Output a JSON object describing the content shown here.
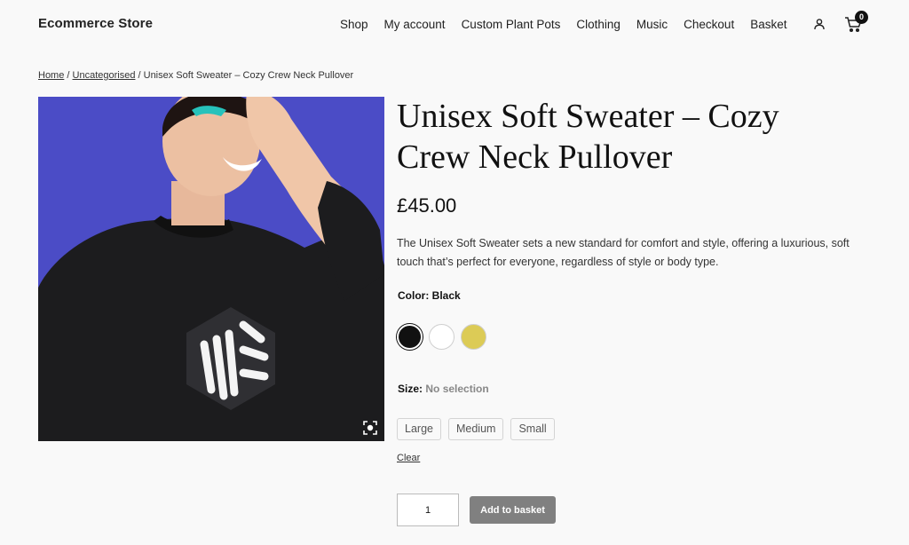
{
  "header": {
    "site_title": "Ecommerce Store",
    "nav": [
      "Shop",
      "My account",
      "Custom Plant Pots",
      "Clothing",
      "Music",
      "Checkout",
      "Basket"
    ],
    "cart_count": "0",
    "icons": {
      "account": "user-icon",
      "cart": "cart-icon"
    }
  },
  "breadcrumb": {
    "home": "Home",
    "sep1": " / ",
    "category": "Uncategorised",
    "sep2": " / ",
    "current": "Unisex Soft Sweater – Cozy Crew Neck Pullover"
  },
  "product": {
    "title": "Unisex Soft Sweater – Cozy Crew Neck Pullover",
    "price": "£45.00",
    "description": "The Unisex Soft Sweater sets a new standard for comfort and style, offering a luxurious, soft touch that’s perfect for everyone, regardless of style or body type.",
    "color_label": "Color:",
    "color_value": "Black",
    "colors": [
      {
        "name": "Black",
        "hex": "#111111",
        "selected": true
      },
      {
        "name": "White",
        "hex": "#ffffff",
        "selected": false
      },
      {
        "name": "Yellow",
        "hex": "#dccb56",
        "selected": false
      }
    ],
    "size_label": "Size:",
    "size_value": "No selection",
    "sizes": [
      "Large",
      "Medium",
      "Small"
    ],
    "clear_label": "Clear",
    "quantity": "1",
    "add_to_basket": "Add to basket",
    "image_bg": "#4b4cc6"
  }
}
